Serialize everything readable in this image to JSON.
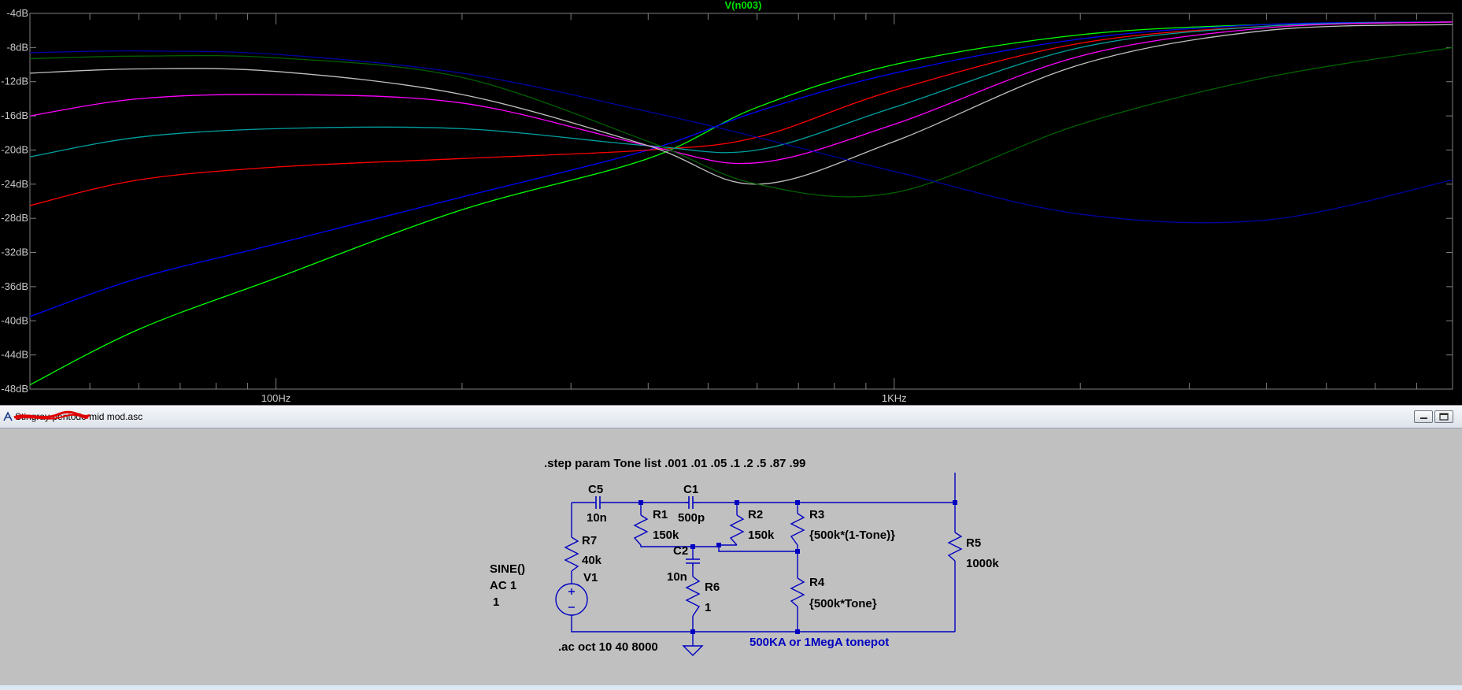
{
  "plot": {
    "trace_title": "V(n003)",
    "y_ticks": [
      "-4dB",
      "-8dB",
      "-12dB",
      "-16dB",
      "-20dB",
      "-24dB",
      "-28dB",
      "-32dB",
      "-36dB",
      "-40dB",
      "-44dB",
      "-48dB"
    ],
    "x_major_labels": [
      "100Hz",
      "1KHz"
    ],
    "background": "#000000",
    "grid_color": "#808080",
    "trace_title_color": "#00e000"
  },
  "chart_data": {
    "type": "line",
    "title": "V(n003)",
    "x_scale": "log",
    "x_unit": "Hz",
    "y_unit": "dB",
    "xlim": [
      40,
      8000
    ],
    "ylim": [
      -48,
      -4
    ],
    "grid": true,
    "series": [
      {
        "color": "#00ff00",
        "x": [
          40,
          60,
          100,
          200,
          400,
          600,
          1000,
          2000,
          4000,
          8000
        ],
        "y": [
          -47.5,
          -41,
          -35,
          -27,
          -21,
          -15,
          -10,
          -6.5,
          -5.3,
          -5
        ]
      },
      {
        "color": "#0000ff",
        "x": [
          40,
          60,
          100,
          200,
          400,
          600,
          1000,
          2000,
          4000,
          8000
        ],
        "y": [
          -39.5,
          -35,
          -31,
          -25.5,
          -20,
          -15.5,
          -11,
          -7,
          -5.3,
          -5
        ]
      },
      {
        "color": "#ff0000",
        "x": [
          40,
          60,
          100,
          200,
          400,
          600,
          1000,
          2000,
          4000,
          8000
        ],
        "y": [
          -26.5,
          -23.5,
          -22,
          -21,
          -20,
          -18.5,
          -13,
          -7.5,
          -5.5,
          -5
        ]
      },
      {
        "color": "#00a0a0",
        "x": [
          40,
          60,
          100,
          200,
          400,
          600,
          1000,
          2000,
          4000,
          8000
        ],
        "y": [
          -20.8,
          -18.5,
          -17.5,
          -17.5,
          -19.5,
          -20,
          -15,
          -8,
          -5.5,
          -5
        ]
      },
      {
        "color": "#ff00ff",
        "x": [
          40,
          60,
          100,
          200,
          400,
          600,
          1000,
          2000,
          4000,
          8000
        ],
        "y": [
          -16,
          -14,
          -13.5,
          -14.5,
          -19.5,
          -21.5,
          -17,
          -9,
          -5.7,
          -5
        ]
      },
      {
        "color": "#c0c0c0",
        "x": [
          40,
          60,
          100,
          200,
          400,
          600,
          1000,
          2000,
          4000,
          8000
        ],
        "y": [
          -11,
          -10.5,
          -10.8,
          -13.5,
          -19.5,
          -24,
          -19,
          -10,
          -6,
          -5.3
        ]
      },
      {
        "color": "#006000",
        "x": [
          40,
          60,
          100,
          200,
          400,
          600,
          1000,
          2000,
          4000,
          8000
        ],
        "y": [
          -9.3,
          -9,
          -9.2,
          -11.5,
          -19,
          -24,
          -25,
          -17,
          -11.5,
          -8
        ]
      },
      {
        "color": "#0000a0",
        "x": [
          40,
          60,
          100,
          200,
          400,
          600,
          1000,
          2000,
          4000,
          8000
        ],
        "y": [
          -8.6,
          -8.4,
          -8.8,
          -11,
          -15.5,
          -18.5,
          -22.5,
          -27.5,
          -28.2,
          -23.5
        ]
      }
    ]
  },
  "window": {
    "file_name": "Stingray pentode mid mod.asc",
    "minimize_label": "",
    "maximize_label": ""
  },
  "schematic": {
    "step_directive": ".step param Tone list .001 .01 .05 .1 .2 .5 .87  .99",
    "ac_directive": ".ac oct 10 40 8000",
    "tonepot_note": "500KA or 1MegA  tonepot",
    "wire_color": "#0000c0",
    "components": {
      "C5": {
        "name": "C5",
        "value": "10n"
      },
      "C1": {
        "name": "C1",
        "value": "500p"
      },
      "C2": {
        "name": "C2",
        "value": "10n"
      },
      "R1": {
        "name": "R1",
        "value": "150k"
      },
      "R2": {
        "name": "R2",
        "value": "150k"
      },
      "R3": {
        "name": "R3",
        "value": "{500k*(1-Tone)}"
      },
      "R4": {
        "name": "R4",
        "value": "{500k*Tone}"
      },
      "R5": {
        "name": "R5",
        "value": "1000k"
      },
      "R6": {
        "name": "R6",
        "value": "1"
      },
      "R7": {
        "name": "R7",
        "value": "40k"
      },
      "V1": {
        "name": "V1",
        "line1": "SINE()",
        "line2": "AC 1",
        "line3": "1"
      }
    }
  }
}
